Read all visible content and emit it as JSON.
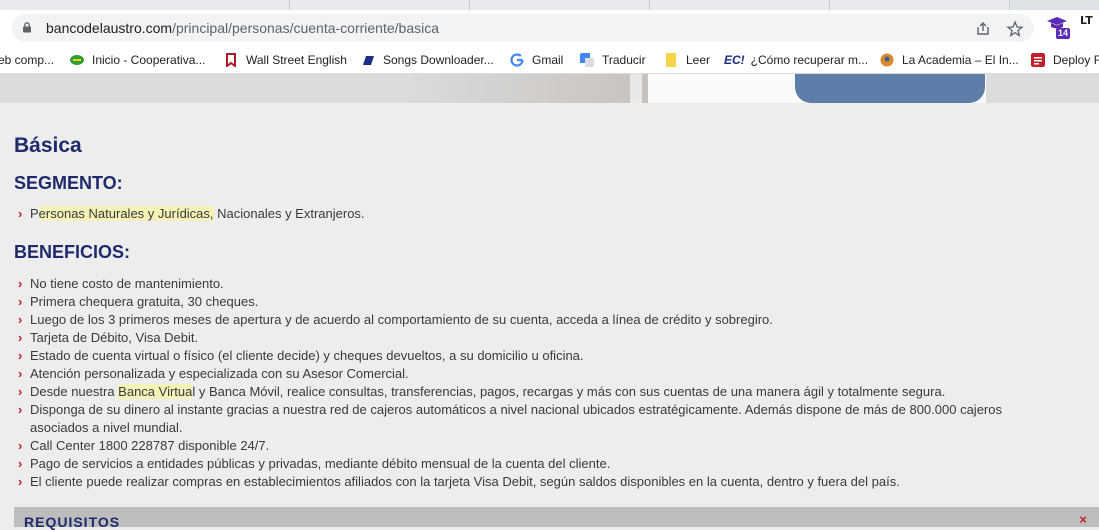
{
  "browser": {
    "url_domain": "bancodelaustro.com",
    "url_path": "/principal/personas/cuenta-corriente/basica",
    "extension_badge": "14",
    "ext_lt_label": "LT",
    "bookmarks": [
      {
        "label": "eb comp...",
        "icon": "page-icon",
        "color": "#888888"
      },
      {
        "label": "Inicio - Cooperativa...",
        "icon": "cooperativa-icon",
        "color": "#2e9e3a"
      },
      {
        "label": "Wall Street English",
        "icon": "wse-icon",
        "color": "#b0182a"
      },
      {
        "label": "Songs Downloader...",
        "icon": "songs-icon",
        "color": "#1d2d8a"
      },
      {
        "label": "Gmail",
        "icon": "google-icon",
        "color": "#4285f4"
      },
      {
        "label": "Traducir",
        "icon": "translate-icon",
        "color": "#4285f4"
      },
      {
        "label": "Leer",
        "icon": "note-icon",
        "color": "#f7d54a"
      },
      {
        "label": "¿Cómo recuperar m...",
        "icon": "ec-icon",
        "color": "#1d2d8a"
      },
      {
        "label": "La Academia – El In...",
        "icon": "academia-icon",
        "color": "#d88a2a"
      },
      {
        "label": "Deploy F",
        "icon": "deploy-icon",
        "color": "#c0202a"
      }
    ],
    "ec_icon_text": "EC!"
  },
  "page": {
    "title": "Básica",
    "segment_heading": "SEGMENTO:",
    "segment_parts": [
      "P",
      "ersonas Naturales y Jurídicas,",
      " Nacionales y Extranjeros."
    ],
    "benefits_heading": "BENEFICIOS:",
    "benefits": [
      "No tiene costo de mantenimiento.",
      "Primera chequera gratuita, 30 cheques.",
      "Luego de los 3 primeros meses de apertura y de acuerdo al comportamiento de su cuenta, acceda a línea de crédito y sobregiro.",
      "Tarjeta de Débito, Visa Debit.",
      "Estado de cuenta virtual o físico (el cliente decide) y cheques devueltos, a su domicilio u oficina.",
      "Atención personalizada y especializada con su Asesor Comercial."
    ],
    "virtual_parts": [
      "Desde nuestra ",
      "Banca Virtua",
      "l y Banca Móvil, realice consultas, transferencias, pagos, recargas y más con sus cuentas de una manera ágil y totalmente segura."
    ],
    "cajeros_line1": "Disponga de su dinero al instante gracias a nuestra red de cajeros automáticos a nivel nacional ubicados estratégicamente. Además dispone de más de 800.000 cajeros",
    "cajeros_line2": "asociados a nivel mundial.",
    "benefits_tail": [
      "Call Center 1800 228787 disponible 24/7.",
      "Pago de servicios a entidades públicas y privadas, mediante débito mensual de la cuenta del cliente.",
      "El cliente puede realizar compras en establecimientos afiliados con la tarjeta Visa Debit, según saldos disponibles en la cuenta, dentro y fuera del país."
    ],
    "requisitos_label": "REQUISITOS",
    "chevron": "›",
    "close_mark": "×"
  }
}
